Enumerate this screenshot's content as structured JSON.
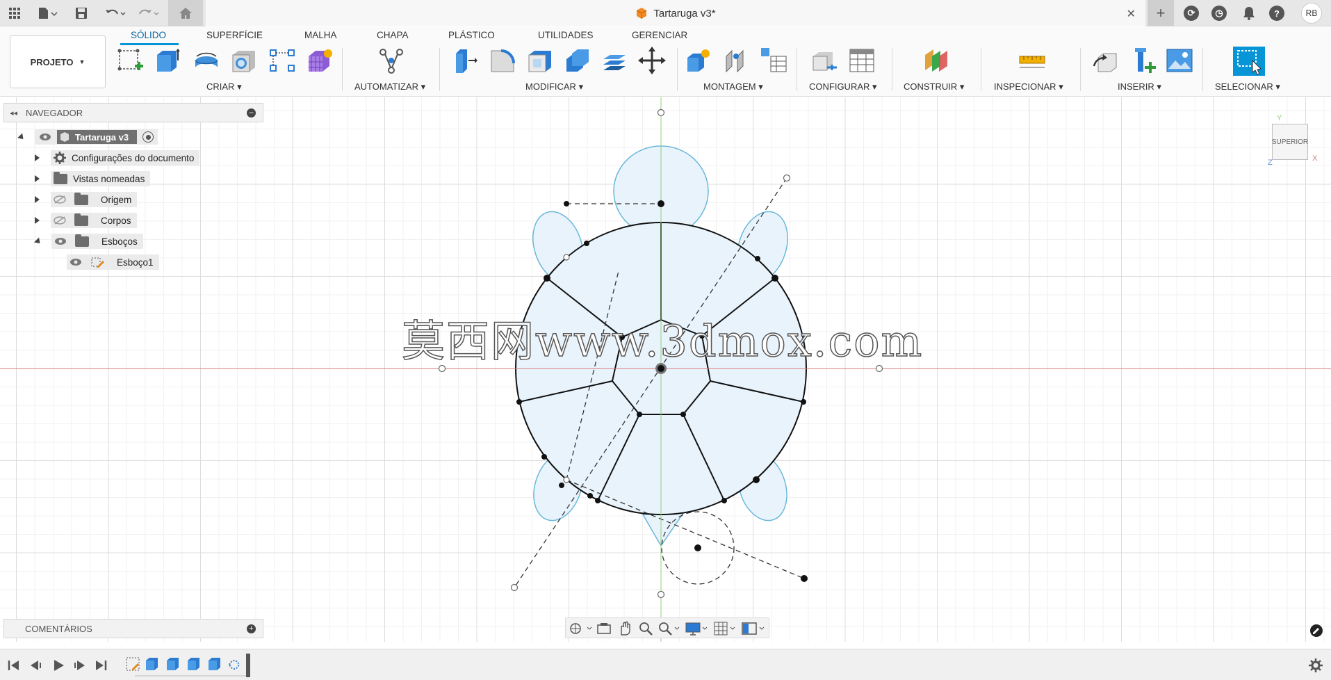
{
  "title": {
    "document_name": "Tartaruga v3*"
  },
  "ribbon": {
    "project_label": "PROJETO",
    "tabs": [
      {
        "label": "SÓLIDO",
        "active": true
      },
      {
        "label": "SUPERFÍCIE"
      },
      {
        "label": "MALHA"
      },
      {
        "label": "CHAPA"
      },
      {
        "label": "PLÁSTICO"
      },
      {
        "label": "UTILIDADES"
      },
      {
        "label": "GERENCIAR"
      }
    ],
    "groups": {
      "criar": "CRIAR",
      "automatizar": "AUTOMATIZAR",
      "modificar": "MODIFICAR",
      "montagem": "MONTAGEM",
      "configurar": "CONFIGURAR",
      "construir": "CONSTRUIR",
      "inspecionar": "INSPECIONAR",
      "inserir": "INSERIR",
      "selecionar": "SELECIONAR"
    }
  },
  "navigator": {
    "header": "NAVEGADOR",
    "root": "Tartaruga v3",
    "items": [
      {
        "label": "Configurações do documento"
      },
      {
        "label": "Vistas nomeadas"
      },
      {
        "label": "Origem"
      },
      {
        "label": "Corpos"
      },
      {
        "label": "Esboços"
      },
      {
        "label": "Esboço1"
      }
    ]
  },
  "comments": {
    "label": "COMENTÁRIOS"
  },
  "viewcube": {
    "face": "SUPERIOR",
    "axis_x": "X",
    "axis_y": "Y",
    "axis_z": "Z"
  },
  "user": {
    "initials": "RB"
  },
  "watermark": {
    "text": "莫西网www.3dmox.com"
  },
  "colors": {
    "accent": "#0696d7",
    "sketch_fill": "#e9f3fb",
    "sketch_profile": "#6ab7d9",
    "origin_x_axis": "#d77a7a",
    "origin_y_axis": "#8fcf7a"
  }
}
